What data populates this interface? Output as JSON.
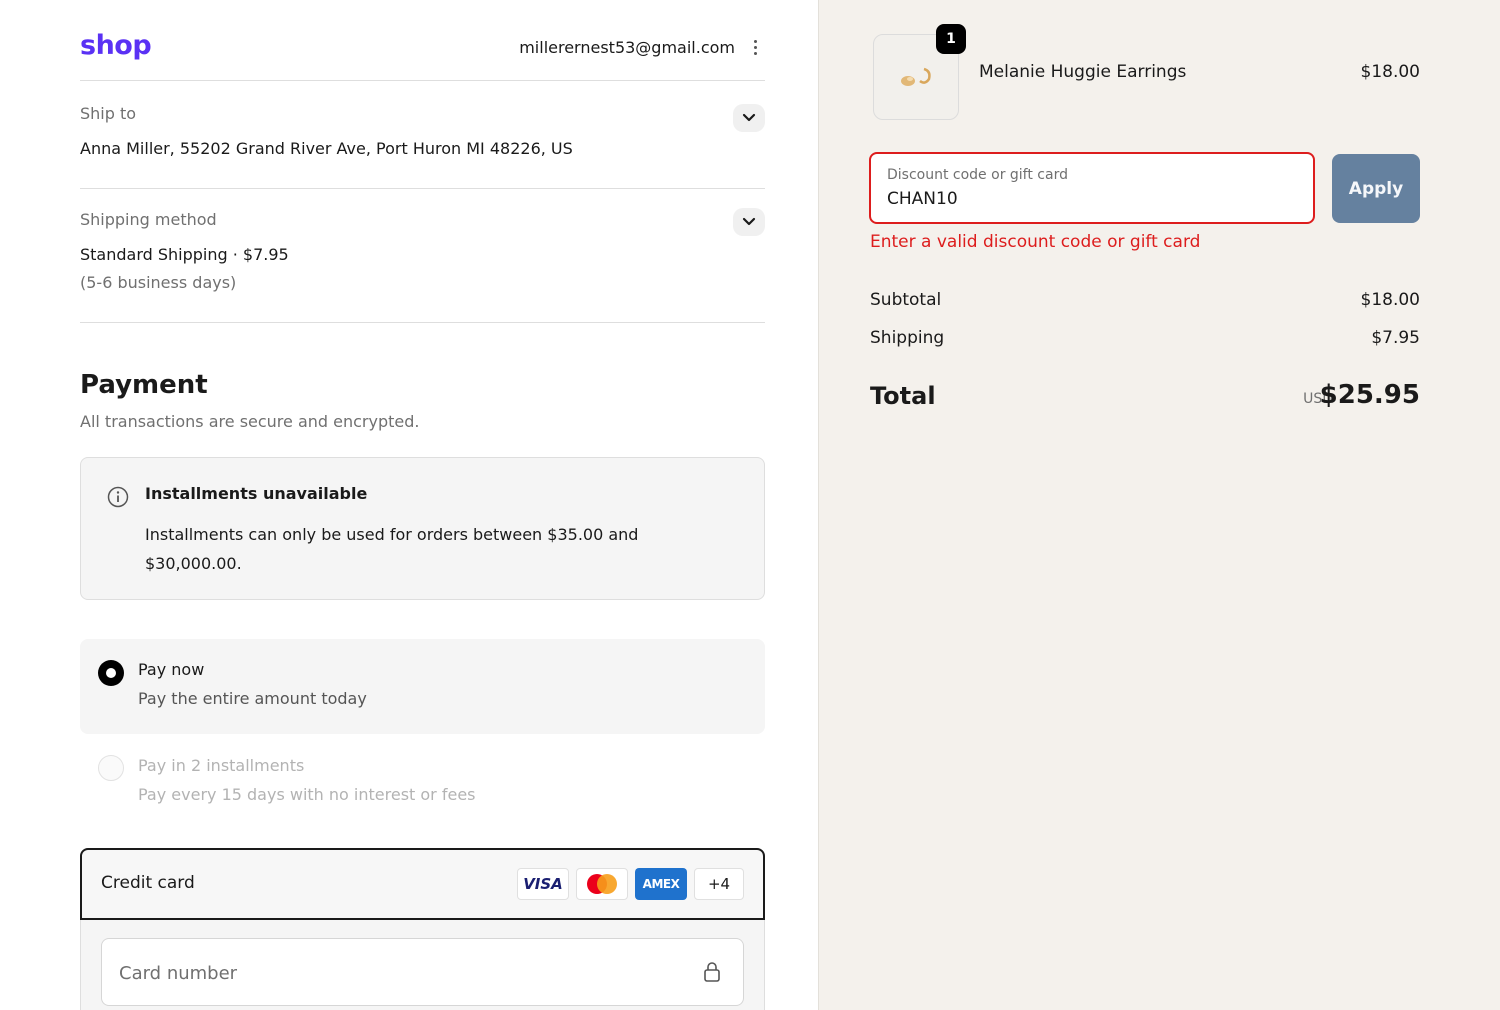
{
  "header": {
    "logo": "shop",
    "email": "millerernest53@gmail.com",
    "menu_icon": "kebab-icon"
  },
  "ship_to": {
    "label": "Ship to",
    "value": "Anna Miller, 55202 Grand River Ave, Port Huron MI 48226, US"
  },
  "shipping_method": {
    "label": "Shipping method",
    "value": "Standard Shipping · $7.95",
    "sub": "(5-6 business days)"
  },
  "payment": {
    "title": "Payment",
    "subtitle": "All transactions are secure and encrypted.",
    "notice": {
      "icon": "info-icon",
      "title": "Installments unavailable",
      "body": "Installments can only be used for orders between $35.00 and $30,000.00."
    },
    "options": [
      {
        "title": "Pay now",
        "sub": "Pay the entire amount today",
        "selected": true
      },
      {
        "title": "Pay in 2 installments",
        "sub": "Pay every 15 days with no interest or fees",
        "selected": false,
        "disabled": true
      }
    ],
    "credit_card": {
      "label": "Credit card",
      "brands": [
        "VISA",
        "mastercard",
        "AMEX"
      ],
      "more": "+4",
      "card_number_placeholder": "Card number"
    }
  },
  "summary": {
    "item": {
      "quantity": "1",
      "name": "Melanie Huggie Earrings",
      "price": "$18.00"
    },
    "discount": {
      "label": "Discount code or gift card",
      "value": "CHAN10",
      "apply_label": "Apply",
      "error": "Enter a valid discount code or gift card"
    },
    "subtotal_label": "Subtotal",
    "subtotal": "$18.00",
    "shipping_label": "Shipping",
    "shipping": "$7.95",
    "total_label": "Total",
    "currency": "USD",
    "total": "$25.95"
  },
  "colors": {
    "brand": "#5a31f4",
    "error": "#dd1d1d",
    "apply_button": "#65819f",
    "summary_bg": "#f4f1ec"
  }
}
